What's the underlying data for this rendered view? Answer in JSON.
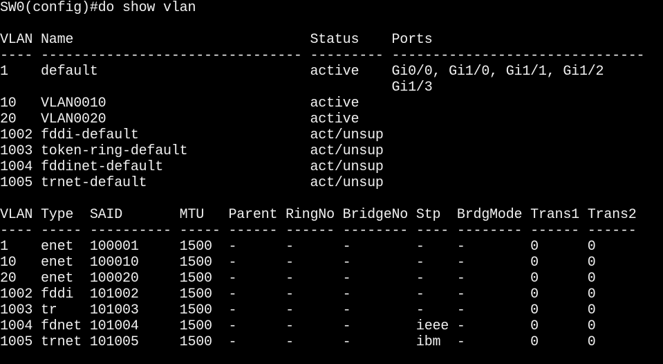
{
  "terminal": {
    "prompt_line": "SW0(config)#do show vlan",
    "vlan_table": {
      "header": "VLAN Name                             Status    Ports",
      "separator": "---- -------------------------------- --------- -------------------------------",
      "rows": [
        "1    default                          active    Gi0/0, Gi1/0, Gi1/1, Gi1/2",
        "                                                Gi1/3",
        "10   VLAN0010                         active",
        "20   VLAN0020                         active",
        "1002 fddi-default                     act/unsup",
        "1003 token-ring-default               act/unsup",
        "1004 fddinet-default                  act/unsup",
        "1005 trnet-default                    act/unsup"
      ]
    },
    "type_table": {
      "header": "VLAN Type  SAID       MTU   Parent RingNo BridgeNo Stp  BrdgMode Trans1 Trans2",
      "separator": "---- ----- ---------- ----- ------ ------ -------- ---- -------- ------ ------",
      "rows": [
        "1    enet  100001     1500  -      -      -        -    -        0      0",
        "10   enet  100010     1500  -      -      -        -    -        0      0",
        "20   enet  100020     1500  -      -      -        -    -        0      0",
        "1002 fddi  101002     1500  -      -      -        -    -        0      0",
        "1003 tr    101003     1500  -      -      -        -    -        0      0",
        "1004 fdnet 101004     1500  -      -      -        ieee -        0      0",
        "1005 trnet 101005     1500  -      -      -        ibm  -        0      0"
      ]
    },
    "colors": {
      "background": "#000000",
      "foreground": "#f0f0f0"
    }
  }
}
